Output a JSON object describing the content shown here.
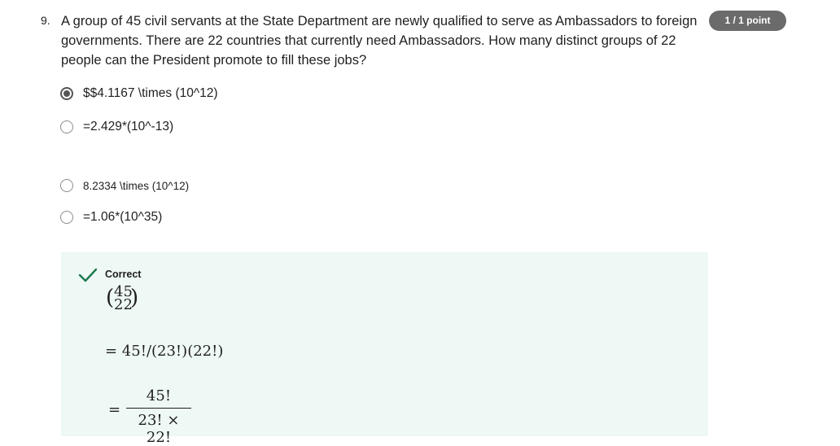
{
  "question": {
    "number": "9.",
    "text": "A group of 45 civil servants at the State Department are newly qualified to serve as Ambassadors to foreign governments. There are 22 countries that currently need Ambassadors. How many distinct groups of 22 people can the President promote to fill these jobs?",
    "points": "1 / 1 point"
  },
  "options": [
    {
      "label": "$$4.1167 \\times (10^12)",
      "selected": true
    },
    {
      "label": "=2.429*(10^-13)",
      "selected": false
    },
    {
      "label": "8.2334 \\times (10^12)",
      "selected": false
    },
    {
      "label": "=1.06*(10^35)",
      "selected": false
    }
  ],
  "feedback": {
    "status": "Correct",
    "status_color": "#1b7a4f",
    "background": "#eef8f4",
    "binom_top": "45",
    "binom_bottom": "22",
    "line1": "= 45!/(23!)(22!)",
    "eq_sign": "=",
    "frac_num": "45!",
    "frac_den": "23! × 22!"
  }
}
